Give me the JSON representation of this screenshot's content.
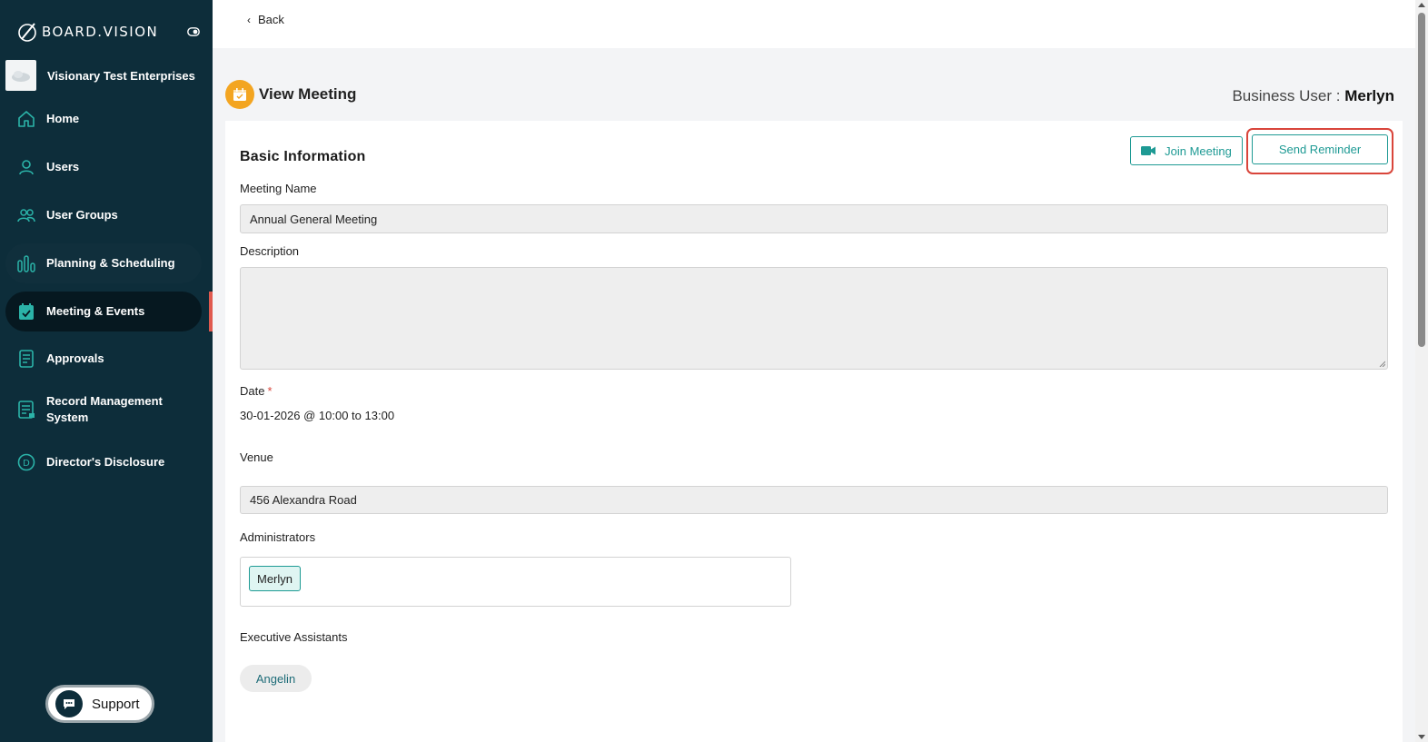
{
  "app": {
    "logo_text": "BOARD.VISION",
    "organization": "Visionary Test Enterprises"
  },
  "sidebar": {
    "items": [
      {
        "label": "Home",
        "icon": "home-icon"
      },
      {
        "label": "Users",
        "icon": "user-icon"
      },
      {
        "label": "User Groups",
        "icon": "user-groups-icon"
      },
      {
        "label": "Planning & Scheduling",
        "icon": "bar-chart-icon"
      },
      {
        "label": "Meeting & Events",
        "icon": "calendar-check-icon",
        "active": true
      },
      {
        "label": "Approvals",
        "icon": "document-icon"
      },
      {
        "label": "Record Management System",
        "icon": "record-icon"
      },
      {
        "label": "Director's Disclosure",
        "icon": "letter-d-circle-icon"
      }
    ],
    "support_label": "Support"
  },
  "topbar": {
    "back_label": "Back"
  },
  "header": {
    "title": "View Meeting",
    "user_prefix": "Business User : ",
    "user_name": "Merlyn"
  },
  "actions": {
    "join_label": "Join Meeting",
    "remind_label": "Send Reminder"
  },
  "form": {
    "section_title": "Basic Information",
    "meeting_name_label": "Meeting Name",
    "meeting_name_value": "Annual General Meeting",
    "description_label": "Description",
    "description_value": "",
    "date_label": "Date",
    "date_required": "*",
    "date_value": "30-01-2026 @ 10:00 to 13:00",
    "venue_label": "Venue",
    "venue_value": "456 Alexandra Road",
    "administrators_label": "Administrators",
    "administrators": [
      "Merlyn"
    ],
    "executive_assistants_label": "Executive Assistants",
    "executive_assistants": [
      "Angelin"
    ]
  },
  "colors": {
    "sidebar_bg": "#0d2d3a",
    "accent": "#1e9a94",
    "highlight": "#d9453b",
    "page_icon": "#f3a521"
  }
}
